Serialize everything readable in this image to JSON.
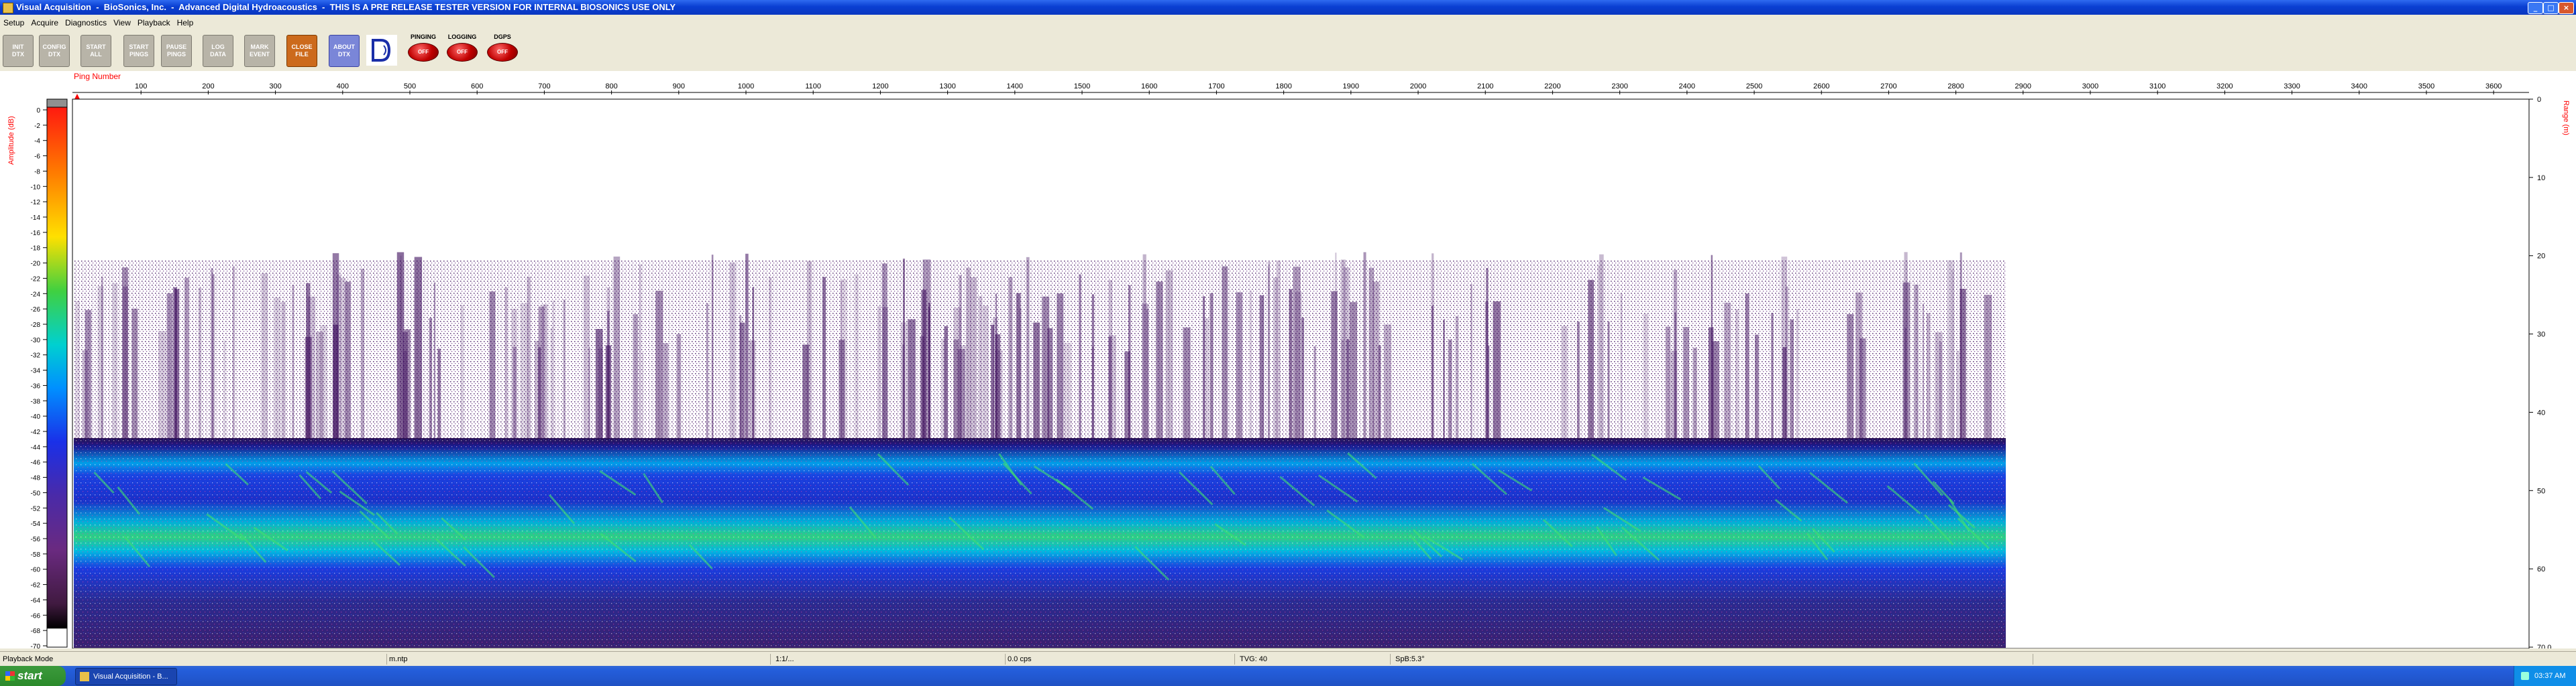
{
  "titlebar": {
    "title": "Visual Acquisition  -  BioSonics, Inc.  -  Advanced Digital Hydroacoustics  -  THIS IS A PRE RELEASE TESTER VERSION FOR INTERNAL BIOSONICS USE ONLY",
    "minimize": "_",
    "maximize": "□",
    "close": "×"
  },
  "menu": [
    "Setup",
    "Acquire",
    "Diagnostics",
    "View",
    "Playback",
    "Help"
  ],
  "toolbar": {
    "buttons": [
      {
        "line1": "INIT",
        "line2": "DTX"
      },
      {
        "line1": "CONFIG",
        "line2": "DTX"
      },
      {
        "line1": "START",
        "line2": "ALL"
      },
      {
        "line1": "START",
        "line2": "PINGS"
      },
      {
        "line1": "PAUSE",
        "line2": "PINGS"
      },
      {
        "line1": "LOG",
        "line2": "DATA"
      },
      {
        "line1": "MARK",
        "line2": "EVENT"
      },
      {
        "line1": "CLOSE",
        "line2": "FILE"
      },
      {
        "line1": "ABOUT",
        "line2": "DTX"
      }
    ],
    "indicators": [
      {
        "label": "PINGING",
        "state": "OFF"
      },
      {
        "label": "LOGGING",
        "state": "OFF"
      },
      {
        "label": "DGPS",
        "state": "OFF"
      }
    ]
  },
  "echogram": {
    "x_axis_label": "Ping Number",
    "x_ticks": [
      "100",
      "200",
      "300",
      "400",
      "500",
      "600",
      "700",
      "800",
      "900",
      "1000",
      "1100",
      "1200",
      "1300",
      "1400",
      "1500",
      "1600",
      "1700",
      "1800",
      "1900",
      "2000",
      "2100",
      "2200",
      "2300",
      "2400",
      "2500",
      "2600",
      "2700",
      "2800",
      "2900",
      "3000",
      "3100",
      "3200",
      "3300",
      "3400",
      "3500",
      "3600"
    ],
    "colorbar_label": "Amplitude (dB)",
    "colorbar_ticks": [
      "0",
      "-2",
      "-4",
      "-6",
      "-8",
      "-10",
      "-12",
      "-14",
      "-16",
      "-18",
      "-20",
      "-22",
      "-24",
      "-26",
      "-28",
      "-30",
      "-32",
      "-34",
      "-36",
      "-38",
      "-40",
      "-42",
      "-44",
      "-46",
      "-48",
      "-50",
      "-52",
      "-54",
      "-56",
      "-58",
      "-60",
      "-62",
      "-64",
      "-66",
      "-68",
      "-70"
    ],
    "right_axis_label": "Range (m)",
    "range_ticks": [
      "0",
      "10",
      "20",
      "30",
      "40",
      "50",
      "60",
      "70.0"
    ],
    "colors": {
      "axis_label": "#ff0000",
      "ping_marker": "#ff0000",
      "colormap": [
        "#ffffff",
        "#ff3a1a",
        "#ff9000",
        "#ffe600",
        "#88e030",
        "#10c060",
        "#00d4d4",
        "#00a8ff",
        "#1f5cff",
        "#1a20e0",
        "#3c2aa0",
        "#5a2a80",
        "#401a50",
        "#000000"
      ]
    }
  },
  "statusbar": [
    "Playback Mode",
    "m.ntp",
    "1:1/...",
    "0.0 cps",
    "TVG: 40",
    "SpB:5.3°"
  ],
  "taskbar": {
    "start": "start",
    "item": "Visual Acquisition - B...",
    "clock": "03:37 AM"
  }
}
